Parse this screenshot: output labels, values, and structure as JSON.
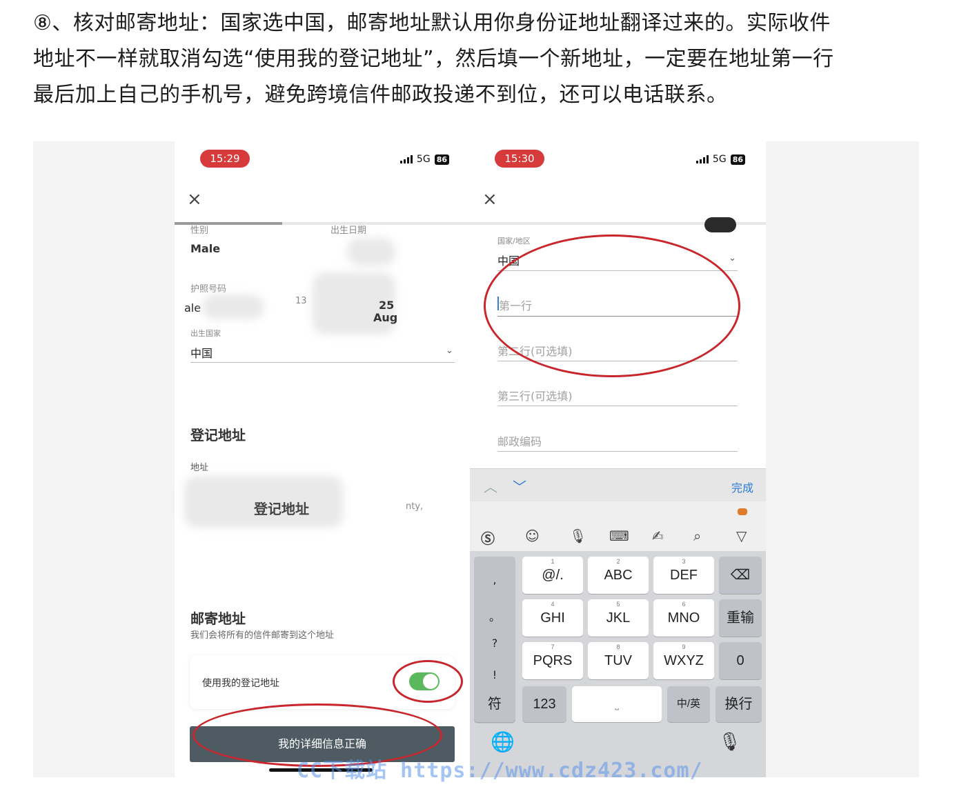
{
  "article": {
    "line1": "⑧、核对邮寄地址：国家选中国，邮寄地址默认用你身份证地址翻译过来的。实际收件",
    "line2": "地址不一样就取消勾选“使用我的登记地址”，然后填一个新地址，一定要在地址第一行",
    "line3": "最后加上自己的手机号，避免跨境信件邮政投递不到位，还可以电话联系。"
  },
  "left_phone": {
    "time": "15:29",
    "network": "5G",
    "battery": "86",
    "close": "×",
    "gender_label": "性别",
    "gender_value": "Male",
    "birth_label": "出生日期",
    "passport_label": "护照号码",
    "passport_fragment": "ale",
    "partial_13": "13",
    "partial_month": "Aug",
    "partial_25": "25",
    "birth_country_label": "出生国家",
    "birth_country_value": "中国",
    "registered_title": "登记地址",
    "address_label": "地址",
    "address_overlay": "登记地址",
    "address_fragment": "nty,",
    "mailing_title": "邮寄地址",
    "mailing_sub": "我们会将所有的信件邮寄到这个地址",
    "use_registered_label": "使用我的登记地址",
    "use_registered_on": true,
    "confirm_button": "我的详细信息正确"
  },
  "right_phone": {
    "time": "15:30",
    "network": "5G",
    "battery": "86",
    "close": "×",
    "country_label": "国家/地区",
    "country_value": "中国",
    "line1_placeholder": "第一行",
    "line2_placeholder": "第二行(可选填)",
    "line3_placeholder": "第三行(可选填)",
    "postcode_placeholder": "邮政编码",
    "keyboard": {
      "done": "完成",
      "punct": [
        ",",
        "。",
        "?",
        "!"
      ],
      "rows": [
        [
          {
            "n": "1",
            "t": "@/."
          },
          {
            "n": "2",
            "t": "ABC"
          },
          {
            "n": "3",
            "t": "DEF"
          }
        ],
        [
          {
            "n": "4",
            "t": "GHI"
          },
          {
            "n": "5",
            "t": "JKL"
          },
          {
            "n": "6",
            "t": "MNO"
          }
        ],
        [
          {
            "n": "7",
            "t": "PQRS"
          },
          {
            "n": "8",
            "t": "TUV"
          },
          {
            "n": "9",
            "t": "WXYZ"
          }
        ]
      ],
      "backspace": "⌫",
      "retype": "重输",
      "zero": "0",
      "symbol": "符",
      "num123": "123",
      "lang": "中/英",
      "enter": "换行"
    }
  },
  "watermark": "CC下载站 https://www.cdz423.com/"
}
